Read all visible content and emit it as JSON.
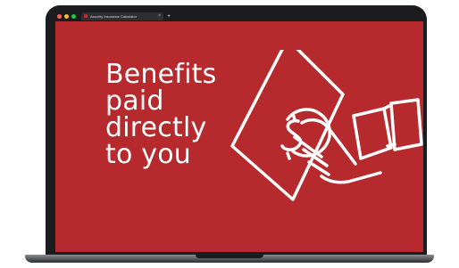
{
  "browser": {
    "window_controls": [
      {
        "name": "close",
        "color": "#ff5f57"
      },
      {
        "name": "minimize",
        "color": "#febc2e"
      },
      {
        "name": "maximize",
        "color": "#28c840"
      }
    ],
    "tab": {
      "title": "Assurity Insurance Calculator",
      "close_label": "×",
      "favicon": "assurity-logo-icon"
    },
    "new_tab_label": "+"
  },
  "hero": {
    "background_color": "#b62a2d",
    "lines": [
      "Benefits",
      "paid",
      "directly",
      "to you"
    ]
  },
  "illustration": {
    "icon": "hand-holding-cash-icon",
    "symbol": "$"
  }
}
